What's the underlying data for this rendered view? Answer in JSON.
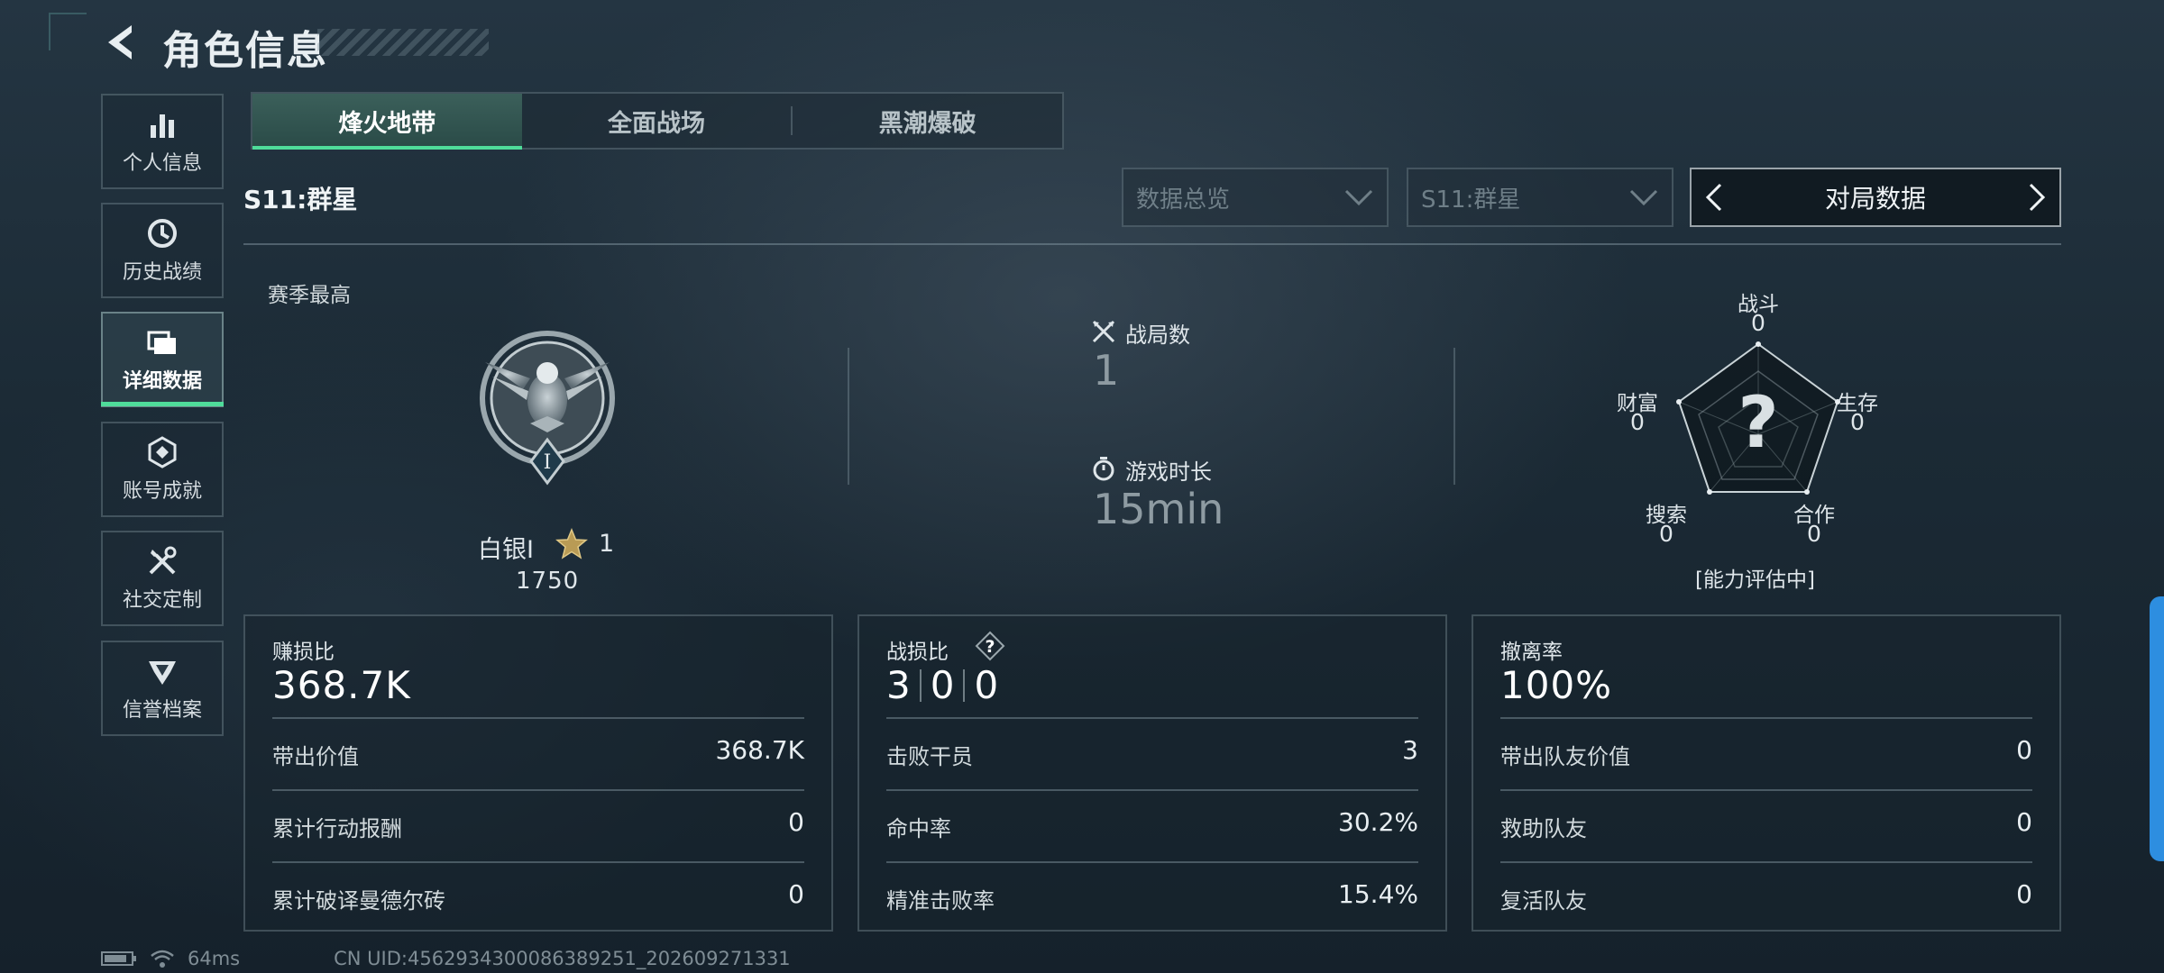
{
  "header": {
    "title": "角色信息",
    "back_icon": "back-arrow-icon"
  },
  "sidebar": {
    "items": [
      {
        "label": "个人信息",
        "icon": "bar-chart-icon",
        "active": false
      },
      {
        "label": "历史战绩",
        "icon": "history-clock-icon",
        "active": false
      },
      {
        "label": "详细数据",
        "icon": "folder-icon",
        "active": true
      },
      {
        "label": "账号成就",
        "icon": "achievement-badge-icon",
        "active": false
      },
      {
        "label": "社交定制",
        "icon": "tools-icon",
        "active": false
      },
      {
        "label": "信誉档案",
        "icon": "emblem-icon",
        "active": false
      }
    ]
  },
  "tabs": [
    {
      "label": "烽火地带",
      "active": true
    },
    {
      "label": "全面战场",
      "active": false
    },
    {
      "label": "黑潮爆破",
      "active": false
    }
  ],
  "season": {
    "label": "S11:群星"
  },
  "filters": {
    "overview": "数据总览",
    "season_select": "S11:群星",
    "mode_switch": "对局数据"
  },
  "rank": {
    "section_label": "赛季最高",
    "name": "白银I",
    "stars": "1",
    "points": "1750",
    "badge_numeral": "I"
  },
  "stats": {
    "matches_label": "战局数",
    "matches_value": "1",
    "playtime_label": "游戏时长",
    "playtime_value": "15min"
  },
  "radar": {
    "center_mark": "?",
    "status": "[能力评估中]",
    "axes": [
      {
        "label": "战斗",
        "value": "0"
      },
      {
        "label": "生存",
        "value": "0"
      },
      {
        "label": "合作",
        "value": "0"
      },
      {
        "label": "搜索",
        "value": "0"
      },
      {
        "label": "财富",
        "value": "0"
      }
    ]
  },
  "panels": {
    "profit": {
      "title": "赚损比",
      "value": "368.7K",
      "rows": [
        {
          "label": "带出价值",
          "value": "368.7K"
        },
        {
          "label": "累计行动报酬",
          "value": "0"
        },
        {
          "label": "累计破译曼德尔砖",
          "value": "0"
        }
      ]
    },
    "combat": {
      "title": "战损比",
      "help_mark": "?",
      "kd": [
        "3",
        "0",
        "0"
      ],
      "rows": [
        {
          "label": "击败干员",
          "value": "3"
        },
        {
          "label": "命中率",
          "value": "30.2%"
        },
        {
          "label": "精准击败率",
          "value": "15.4%"
        }
      ]
    },
    "extract": {
      "title": "撤离率",
      "value": "100%",
      "rows": [
        {
          "label": "带出队友价值",
          "value": "0"
        },
        {
          "label": "救助队友",
          "value": "0"
        },
        {
          "label": "复活队友",
          "value": "0"
        }
      ]
    }
  },
  "status_bar": {
    "ping": "64ms",
    "uid": "CN UID:4562934300086389251_202609271331"
  },
  "colors": {
    "accent": "#4fdc9a",
    "edge_tab": "#2d8ee0"
  }
}
